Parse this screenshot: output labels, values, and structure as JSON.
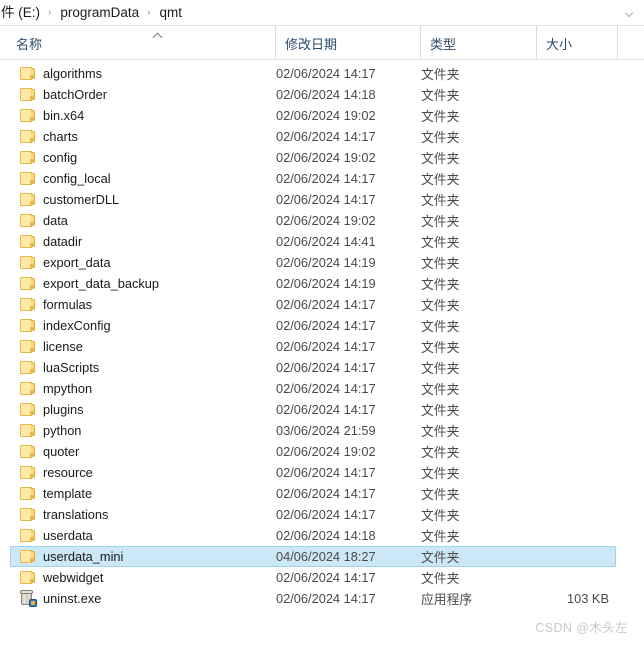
{
  "window": {
    "title": "qmt",
    "type": "file-explorer"
  },
  "address_bar": {
    "crumbs": [
      {
        "label": "件 (E:)"
      },
      {
        "label": "programData"
      },
      {
        "label": "qmt"
      }
    ],
    "separator": "›",
    "dropdown_icon": "chevron-down-icon"
  },
  "columns": {
    "name": "名称",
    "date_modified": "修改日期",
    "type": "类型",
    "size": "大小",
    "sort_column": "名称",
    "sort_direction": "ascending",
    "sort_indicator": "^"
  },
  "types": {
    "folder": "文件夹",
    "application": "应用程序"
  },
  "colors": {
    "selection_fill": "#cce8f7",
    "selection_border": "#9fd4ef",
    "header_text": "#2b4b6b",
    "folder_icon": "#ffe9a8",
    "folder_icon_border": "#e8b84b"
  },
  "files": [
    {
      "name": "algorithms",
      "date": "02/06/2024 14:17",
      "type": "文件夹",
      "size": "",
      "icon": "folder-icon",
      "selected": false
    },
    {
      "name": "batchOrder",
      "date": "02/06/2024 14:18",
      "type": "文件夹",
      "size": "",
      "icon": "folder-icon",
      "selected": false
    },
    {
      "name": "bin.x64",
      "date": "02/06/2024 19:02",
      "type": "文件夹",
      "size": "",
      "icon": "folder-icon",
      "selected": false
    },
    {
      "name": "charts",
      "date": "02/06/2024 14:17",
      "type": "文件夹",
      "size": "",
      "icon": "folder-icon",
      "selected": false
    },
    {
      "name": "config",
      "date": "02/06/2024 19:02",
      "type": "文件夹",
      "size": "",
      "icon": "folder-icon",
      "selected": false
    },
    {
      "name": "config_local",
      "date": "02/06/2024 14:17",
      "type": "文件夹",
      "size": "",
      "icon": "folder-icon",
      "selected": false
    },
    {
      "name": "customerDLL",
      "date": "02/06/2024 14:17",
      "type": "文件夹",
      "size": "",
      "icon": "folder-icon",
      "selected": false
    },
    {
      "name": "data",
      "date": "02/06/2024 19:02",
      "type": "文件夹",
      "size": "",
      "icon": "folder-icon",
      "selected": false
    },
    {
      "name": "datadir",
      "date": "02/06/2024 14:41",
      "type": "文件夹",
      "size": "",
      "icon": "folder-icon",
      "selected": false
    },
    {
      "name": "export_data",
      "date": "02/06/2024 14:19",
      "type": "文件夹",
      "size": "",
      "icon": "folder-icon",
      "selected": false
    },
    {
      "name": "export_data_backup",
      "date": "02/06/2024 14:19",
      "type": "文件夹",
      "size": "",
      "icon": "folder-icon",
      "selected": false
    },
    {
      "name": "formulas",
      "date": "02/06/2024 14:17",
      "type": "文件夹",
      "size": "",
      "icon": "folder-icon",
      "selected": false
    },
    {
      "name": "indexConfig",
      "date": "02/06/2024 14:17",
      "type": "文件夹",
      "size": "",
      "icon": "folder-icon",
      "selected": false
    },
    {
      "name": "license",
      "date": "02/06/2024 14:17",
      "type": "文件夹",
      "size": "",
      "icon": "folder-icon",
      "selected": false
    },
    {
      "name": "luaScripts",
      "date": "02/06/2024 14:17",
      "type": "文件夹",
      "size": "",
      "icon": "folder-icon",
      "selected": false
    },
    {
      "name": "mpython",
      "date": "02/06/2024 14:17",
      "type": "文件夹",
      "size": "",
      "icon": "folder-icon",
      "selected": false
    },
    {
      "name": "plugins",
      "date": "02/06/2024 14:17",
      "type": "文件夹",
      "size": "",
      "icon": "folder-icon",
      "selected": false
    },
    {
      "name": "python",
      "date": "03/06/2024 21:59",
      "type": "文件夹",
      "size": "",
      "icon": "folder-icon",
      "selected": false
    },
    {
      "name": "quoter",
      "date": "02/06/2024 19:02",
      "type": "文件夹",
      "size": "",
      "icon": "folder-icon",
      "selected": false
    },
    {
      "name": "resource",
      "date": "02/06/2024 14:17",
      "type": "文件夹",
      "size": "",
      "icon": "folder-icon",
      "selected": false
    },
    {
      "name": "template",
      "date": "02/06/2024 14:17",
      "type": "文件夹",
      "size": "",
      "icon": "folder-icon",
      "selected": false
    },
    {
      "name": "translations",
      "date": "02/06/2024 14:17",
      "type": "文件夹",
      "size": "",
      "icon": "folder-icon",
      "selected": false
    },
    {
      "name": "userdata",
      "date": "02/06/2024 14:18",
      "type": "文件夹",
      "size": "",
      "icon": "folder-icon",
      "selected": false
    },
    {
      "name": "userdata_mini",
      "date": "04/06/2024 18:27",
      "type": "文件夹",
      "size": "",
      "icon": "folder-icon",
      "selected": true
    },
    {
      "name": "webwidget",
      "date": "02/06/2024 14:17",
      "type": "文件夹",
      "size": "",
      "icon": "folder-icon",
      "selected": false
    },
    {
      "name": "uninst.exe",
      "date": "02/06/2024 14:17",
      "type": "应用程序",
      "size": "103 KB",
      "icon": "exe-icon",
      "selected": false
    }
  ],
  "watermark": {
    "text": "CSDN @木头左"
  }
}
